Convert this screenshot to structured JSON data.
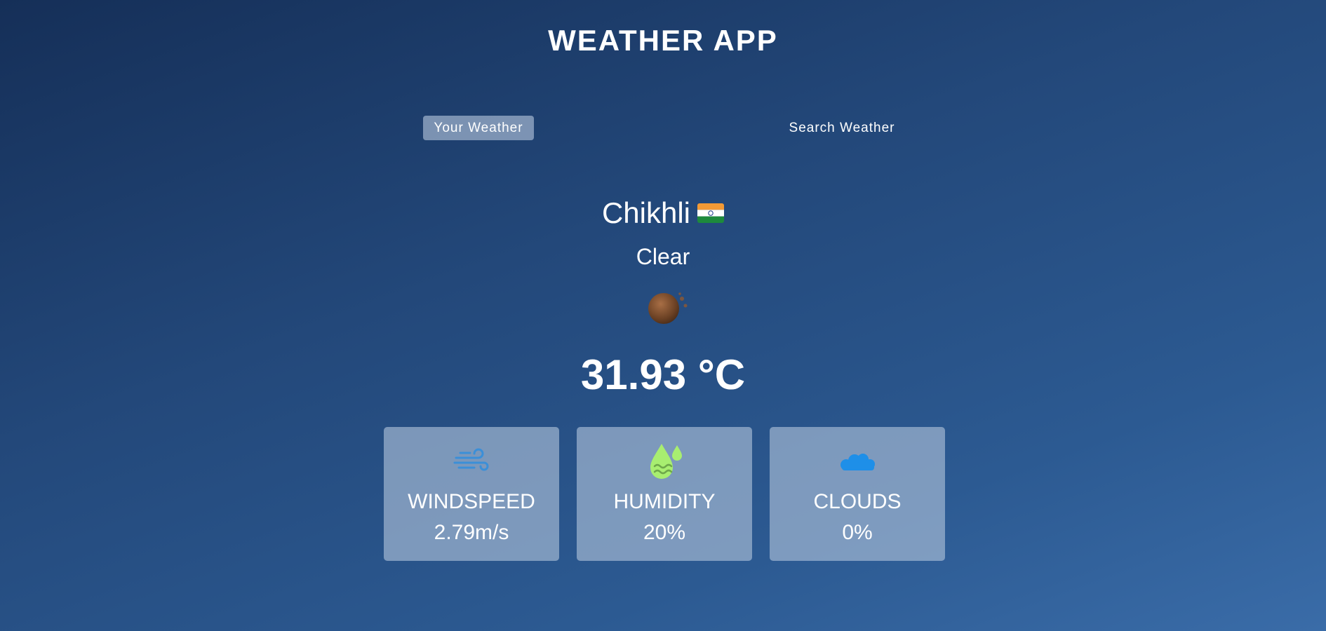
{
  "app": {
    "title": "WEATHER APP"
  },
  "tabs": [
    {
      "label": "Your Weather",
      "active": true
    },
    {
      "label": "Search Weather",
      "active": false
    }
  ],
  "weather": {
    "city": "Chikhli",
    "country_flag": "india-flag-icon",
    "description": "Clear",
    "icon": "clear-night-icon",
    "temperature": "31.93 °C"
  },
  "stats": [
    {
      "label": "WINDSPEED",
      "value": "2.79m/s",
      "icon": "wind-icon"
    },
    {
      "label": "HUMIDITY",
      "value": "20%",
      "icon": "humidity-icon"
    },
    {
      "label": "CLOUDS",
      "value": "0%",
      "icon": "cloud-icon"
    }
  ],
  "colors": {
    "wind_icon": "#3b8fd8",
    "humidity_icon": "#a8ee70",
    "cloud_icon": "#1e8fe8"
  }
}
